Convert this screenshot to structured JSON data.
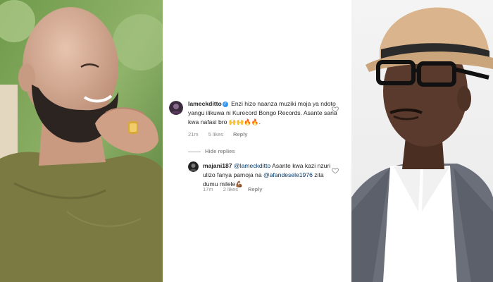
{
  "comments": [
    {
      "username": "lameckditto",
      "verified": true,
      "text": "Enzi hizo naanza  muziki moja ya ndoto yangu ilikuwa ni Kurecord Bongo Records. Asante sana kwa nafasi bro 🙌🙌🔥🔥.",
      "time": "21m",
      "likes": "5 likes",
      "reply_label": "Reply"
    }
  ],
  "hide_replies_label": "Hide replies",
  "reply": {
    "username": "majani187",
    "mention1": "@lameckditto",
    "text1": " Asante kwa kazi nzuri ulizo fanya pamoja na ",
    "mention2": "@afandesele1976",
    "text2": " zita dumu milele💪🏾",
    "time": "17m",
    "likes": "2 likes",
    "reply_label": "Reply"
  },
  "icons": {
    "verified": "verified-badge-icon",
    "like": "heart-outline-icon"
  },
  "colors": {
    "verified_blue": "#3897f0",
    "mention_blue": "#00376b",
    "meta_gray": "#8e8e8e",
    "text_dark": "#262626"
  }
}
